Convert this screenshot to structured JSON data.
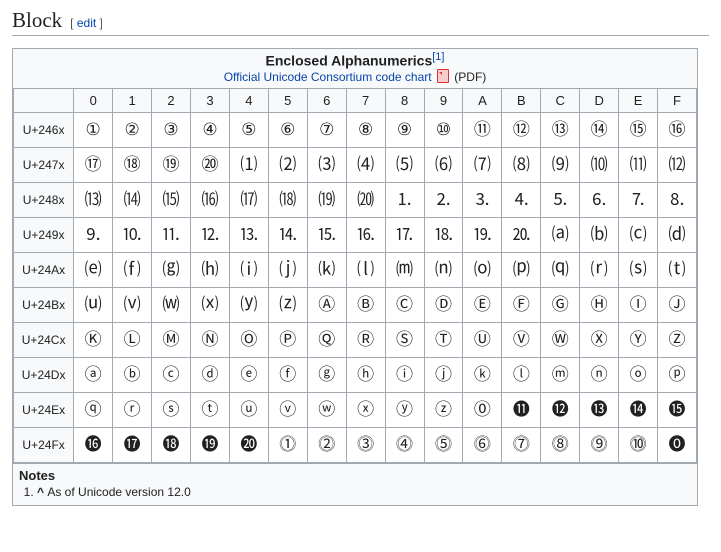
{
  "heading": "Block",
  "edit_label": "edit",
  "chart": {
    "title": "Enclosed Alphanumerics",
    "ref": "[1]",
    "link_text": "Official Unicode Consortium code chart",
    "pdf_label": "(PDF)"
  },
  "columns": [
    "0",
    "1",
    "2",
    "3",
    "4",
    "5",
    "6",
    "7",
    "8",
    "9",
    "A",
    "B",
    "C",
    "D",
    "E",
    "F"
  ],
  "rows": [
    {
      "h": "U+246x",
      "c": [
        "①",
        "②",
        "③",
        "④",
        "⑤",
        "⑥",
        "⑦",
        "⑧",
        "⑨",
        "⑩",
        "⑪",
        "⑫",
        "⑬",
        "⑭",
        "⑮",
        "⑯"
      ]
    },
    {
      "h": "U+247x",
      "c": [
        "⑰",
        "⑱",
        "⑲",
        "⑳",
        "⑴",
        "⑵",
        "⑶",
        "⑷",
        "⑸",
        "⑹",
        "⑺",
        "⑻",
        "⑼",
        "⑽",
        "⑾",
        "⑿"
      ]
    },
    {
      "h": "U+248x",
      "c": [
        "⒀",
        "⒁",
        "⒂",
        "⒃",
        "⒄",
        "⒅",
        "⒆",
        "⒇",
        "⒈",
        "⒉",
        "⒊",
        "⒋",
        "⒌",
        "⒍",
        "⒎",
        "⒏"
      ]
    },
    {
      "h": "U+249x",
      "c": [
        "⒐",
        "⒑",
        "⒒",
        "⒓",
        "⒔",
        "⒕",
        "⒖",
        "⒗",
        "⒘",
        "⒙",
        "⒚",
        "⒛",
        "⒜",
        "⒝",
        "⒞",
        "⒟"
      ]
    },
    {
      "h": "U+24Ax",
      "c": [
        "⒠",
        "⒡",
        "⒢",
        "⒣",
        "⒤",
        "⒥",
        "⒦",
        "⒧",
        "⒨",
        "⒩",
        "⒪",
        "⒫",
        "⒬",
        "⒭",
        "⒮",
        "⒯"
      ]
    },
    {
      "h": "U+24Bx",
      "c": [
        "⒰",
        "⒱",
        "⒲",
        "⒳",
        "⒴",
        "⒵",
        "Ⓐ",
        "Ⓑ",
        "Ⓒ",
        "Ⓓ",
        "Ⓔ",
        "Ⓕ",
        "Ⓖ",
        "Ⓗ",
        "Ⓘ",
        "Ⓙ"
      ]
    },
    {
      "h": "U+24Cx",
      "c": [
        "Ⓚ",
        "Ⓛ",
        "Ⓜ",
        "Ⓝ",
        "Ⓞ",
        "Ⓟ",
        "Ⓠ",
        "Ⓡ",
        "Ⓢ",
        "Ⓣ",
        "Ⓤ",
        "Ⓥ",
        "Ⓦ",
        "Ⓧ",
        "Ⓨ",
        "Ⓩ"
      ]
    },
    {
      "h": "U+24Dx",
      "c": [
        "ⓐ",
        "ⓑ",
        "ⓒ",
        "ⓓ",
        "ⓔ",
        "ⓕ",
        "ⓖ",
        "ⓗ",
        "ⓘ",
        "ⓙ",
        "ⓚ",
        "ⓛ",
        "ⓜ",
        "ⓝ",
        "ⓞ",
        "ⓟ"
      ]
    },
    {
      "h": "U+24Ex",
      "c": [
        "ⓠ",
        "ⓡ",
        "ⓢ",
        "ⓣ",
        "ⓤ",
        "ⓥ",
        "ⓦ",
        "ⓧ",
        "ⓨ",
        "ⓩ",
        "⓪",
        "⓫",
        "⓬",
        "⓭",
        "⓮",
        "⓯"
      ]
    },
    {
      "h": "U+24Fx",
      "c": [
        "⓰",
        "⓱",
        "⓲",
        "⓳",
        "⓴",
        "⓵",
        "⓶",
        "⓷",
        "⓸",
        "⓹",
        "⓺",
        "⓻",
        "⓼",
        "⓽",
        "⓾",
        "⓿"
      ]
    }
  ],
  "notes": {
    "heading": "Notes",
    "items": [
      "As of Unicode version 12.0"
    ],
    "caret": "^"
  }
}
